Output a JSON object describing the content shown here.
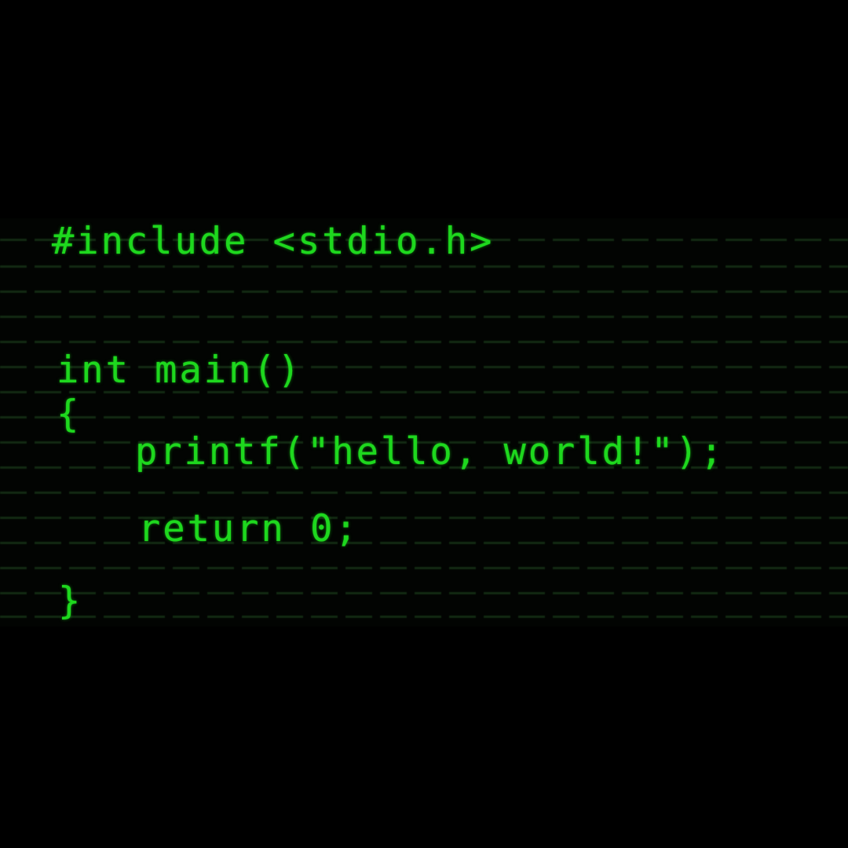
{
  "terminal": {
    "text_color": "#1ed81e",
    "background_color": "#000000",
    "code_lines": [
      "#include <stdio.h>",
      "int main()",
      "{",
      "printf(\"hello, world!\");",
      "return 0;",
      "}"
    ]
  }
}
